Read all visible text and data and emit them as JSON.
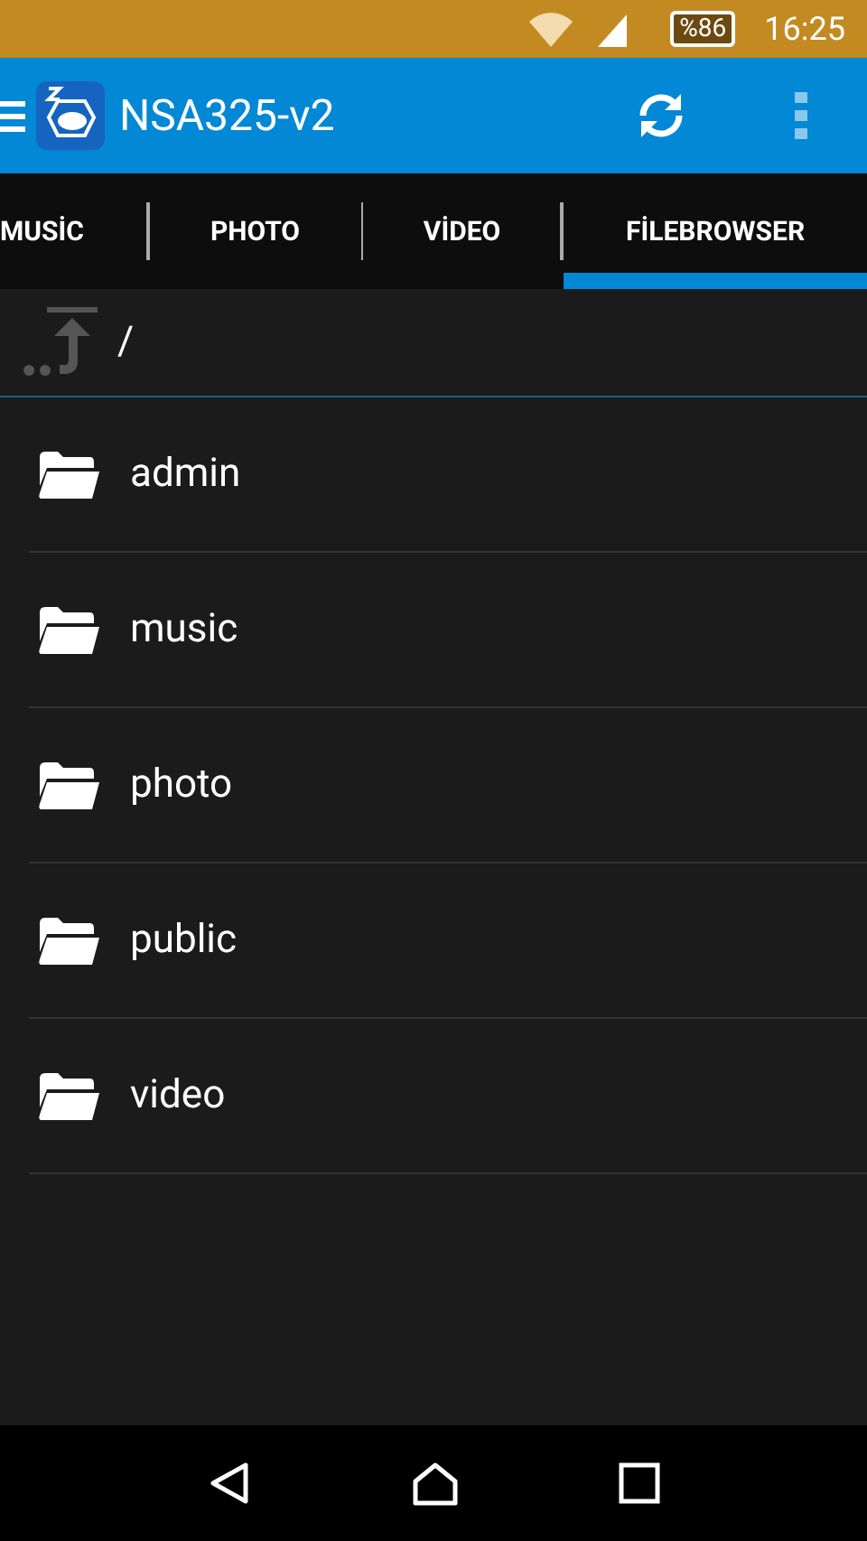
{
  "status_bar": {
    "battery": "%86",
    "time": "16:25"
  },
  "app_bar": {
    "title": "NSA325-v2"
  },
  "tabs": [
    {
      "label": "MUSİC",
      "selected": false
    },
    {
      "label": "PHOTO",
      "selected": false
    },
    {
      "label": "VİDEO",
      "selected": false
    },
    {
      "label": "FİLEBROWSER",
      "selected": true
    }
  ],
  "path": "/",
  "folders": [
    {
      "name": "admin"
    },
    {
      "name": "music"
    },
    {
      "name": "photo"
    },
    {
      "name": "public"
    },
    {
      "name": "video"
    }
  ]
}
